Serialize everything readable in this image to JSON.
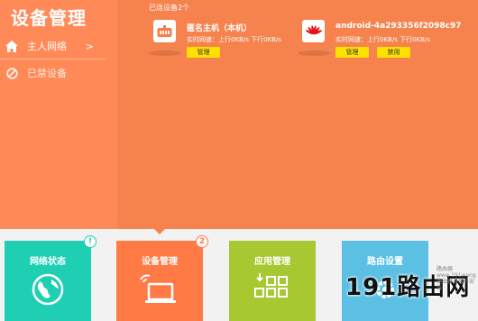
{
  "app": {
    "title": "设备管理"
  },
  "sidebar": {
    "items": [
      {
        "label": "主人网络",
        "chevron": ">",
        "icon": "home-icon"
      },
      {
        "label": "已禁设备",
        "icon": "forbidden-icon"
      }
    ]
  },
  "main": {
    "device_count": "已连设备2个",
    "devices": [
      {
        "name": "匿名主机（本机）",
        "speed": "实时网速：上行0KB/s 下行0KB/s",
        "icon": "router-icon",
        "buttons": [
          "管理"
        ]
      },
      {
        "name": "android-4a293356f2098c97",
        "speed": "实时网速：上行0KB/s 下行0KB/s",
        "icon": "huawei-logo-icon",
        "buttons": [
          "管理",
          "禁用"
        ]
      }
    ]
  },
  "tiles": [
    {
      "label": "网络状态",
      "badge": "!",
      "color": "#1fcfb3",
      "icon": "globe-icon"
    },
    {
      "label": "设备管理",
      "badge": "2",
      "color": "#ff7a45",
      "icon": "laptop-wifi-icon"
    },
    {
      "label": "应用管理",
      "color": "#a8c832",
      "icon": "apps-grid-icon"
    },
    {
      "label": "路由设置",
      "color": "#5bc0e3",
      "icon": "gear-icon"
    }
  ],
  "watermark": {
    "text": "191路由网",
    "side_text": "路由器 www.191wang.com 路由器设置与安装"
  },
  "colors": {
    "sidebar": "#ff8a58",
    "main": "#f6824e",
    "button": "#ffe100"
  }
}
